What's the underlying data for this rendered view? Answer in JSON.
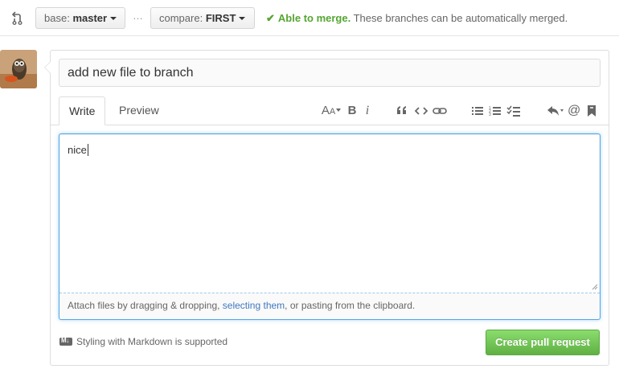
{
  "range": {
    "base_prefix": "base:",
    "base_branch": "master",
    "dots": "…",
    "compare_prefix": "compare:",
    "compare_branch": "FIRST",
    "merge_ok": "Able to merge.",
    "merge_desc": "These branches can be automatically merged."
  },
  "form": {
    "title_value": "add new file to branch",
    "tabs": [
      {
        "label": "Write"
      },
      {
        "label": "Preview"
      }
    ],
    "body_value": "nice",
    "attach_before": "Attach files by dragging & dropping, ",
    "attach_link": "selecting them",
    "attach_after": ", or pasting from the clipboard.",
    "markdown_note": "Styling with Markdown is supported",
    "submit_label": "Create pull request"
  },
  "toolbar": {
    "header_icon": "header-icon",
    "bold": "B",
    "italic": "i",
    "quote": "quote-icon",
    "code": "code-icon",
    "link": "link-icon",
    "ul": "unordered-list-icon",
    "ol": "ordered-list-icon",
    "task": "task-list-icon",
    "reply": "reply-icon",
    "mention": "@",
    "bookmark": "bookmark-icon"
  },
  "colors": {
    "merge_green": "#55a532",
    "button_green": "#60b044",
    "link_blue": "#4078c0",
    "focus_blue": "#51a7e8"
  }
}
